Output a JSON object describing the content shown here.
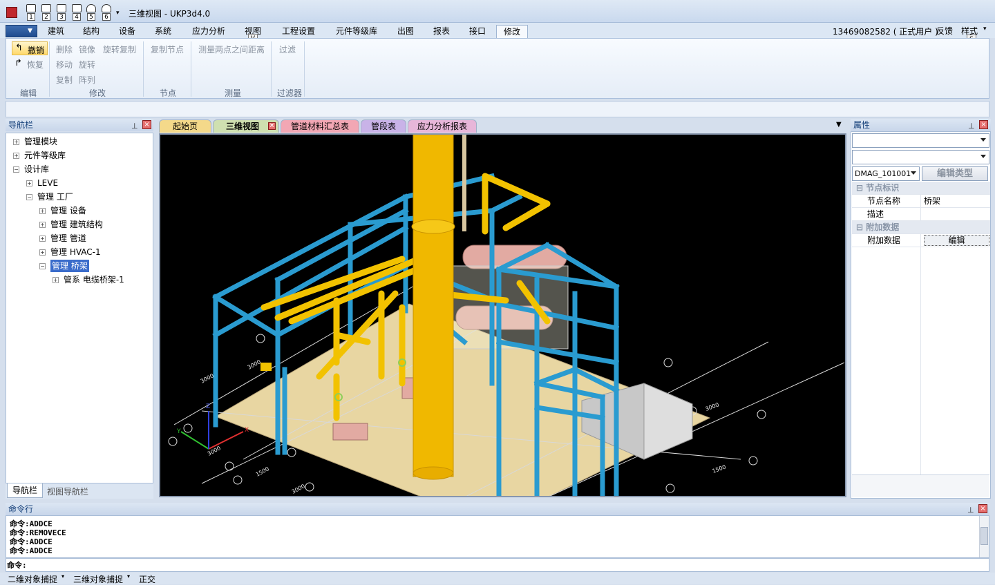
{
  "titlebar": {
    "title": "三维视图 - UKP3d4.0",
    "quick_access": [
      "1",
      "2",
      "3",
      "4",
      "5",
      "6"
    ]
  },
  "menu": {
    "tabs": [
      "建筑",
      "结构",
      "设备",
      "系统",
      "应力分析",
      "视图",
      "工程设置",
      "元件等级库",
      "出图",
      "报表",
      "接口",
      "修改"
    ],
    "active_tab": "修改",
    "hint_key": "V",
    "user": "13469082582 ( 正式用户 )",
    "feedback": "反馈",
    "style": "样式",
    "style_hint_key": "S"
  },
  "ribbon": {
    "edit": {
      "undo": "撤销",
      "redo": "恢复",
      "label": "编辑"
    },
    "modify": {
      "delete": "删除",
      "mirror": "镜像",
      "rotate_copy": "旋转复制",
      "move": "移动",
      "rotate": "旋转",
      "copy": "复制",
      "array": "阵列",
      "label": "修改"
    },
    "node": {
      "copy_node": "复制节点",
      "label": "节点"
    },
    "measure": {
      "measure_two_points": "测量两点之间距离",
      "label": "测量"
    },
    "filter": {
      "filter": "过滤",
      "label": "过滤器"
    }
  },
  "nav_panel": {
    "title": "导航栏",
    "pin": "ᵖ",
    "tree": [
      {
        "label": "管理模块",
        "level": 0
      },
      {
        "label": "元件等级库",
        "level": 0
      },
      {
        "label": "设计库",
        "level": 0
      },
      {
        "label": "LEVE",
        "level": 1
      },
      {
        "label": "管理 工厂",
        "level": 1
      },
      {
        "label": "管理 设备",
        "level": 2
      },
      {
        "label": "管理 建筑结构",
        "level": 2
      },
      {
        "label": "管理 管道",
        "level": 2
      },
      {
        "label": "管理 HVAC-1",
        "level": 2
      },
      {
        "label": "管理 桥架",
        "level": 2
      },
      {
        "label": "管系 电缆桥架-1",
        "level": 3
      }
    ],
    "tabs": [
      "导航栏",
      "视图导航栏"
    ]
  },
  "doc_tabs": [
    {
      "label": "起始页",
      "color": "#f4d98a"
    },
    {
      "label": "三维视图",
      "color": "#cfe0b0"
    },
    {
      "label": "管道材料汇总表",
      "color": "#f2a7b4"
    },
    {
      "label": "管段表",
      "color": "#c9b3e8"
    },
    {
      "label": "应力分析报表",
      "color": "#e7b6d9"
    }
  ],
  "viewport": {
    "background": "#000000",
    "dimension_labels": [
      "3000",
      "3000",
      "1500",
      "3000",
      "3000",
      "1500",
      "3000"
    ],
    "axis_labels": [
      "X",
      "Y",
      "Z"
    ]
  },
  "properties": {
    "title": "属性",
    "type_combo": "DMAG_101001",
    "edit_type_button": "编辑类型",
    "categories": [
      {
        "name": "节点标识",
        "rows": [
          {
            "key": "节点名称",
            "value": "桥架"
          },
          {
            "key": "描述",
            "value": ""
          }
        ]
      },
      {
        "name": "附加数据",
        "rows": [
          {
            "key": "附加数据",
            "value": "编辑"
          }
        ]
      }
    ]
  },
  "command_panel": {
    "title": "命令行",
    "history": [
      "命令:ADDCE",
      "命令:REMOVECE",
      "命令:ADDCE",
      "命令:ADDCE"
    ],
    "prompt": "命令:"
  },
  "statusbar": {
    "items": [
      "二维对象捕捉",
      "三维对象捕捉",
      "正交"
    ]
  },
  "colors": {
    "structure": "#2a9bd0",
    "pipe": "#f2c200",
    "floor": "#e8d6a2",
    "equipment": "#e2aaa2"
  }
}
